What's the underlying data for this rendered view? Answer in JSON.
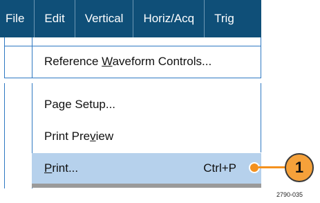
{
  "menubar": {
    "items": [
      "File",
      "Edit",
      "Vertical",
      "Horiz/Acq",
      "Trig"
    ]
  },
  "dropdown": {
    "reference_waveform": {
      "before": "Reference ",
      "mnemonic": "W",
      "after": "aveform Controls..."
    },
    "page_setup": "Page Setup...",
    "print_preview": {
      "before": "Print Pre",
      "mnemonic": "v",
      "after": "iew"
    },
    "print": {
      "mnemonic": "P",
      "after": "rint...",
      "shortcut": "Ctrl+P"
    }
  },
  "callout": {
    "number": "1"
  },
  "figure_id": "2790-035",
  "colors": {
    "menubar_bg": "#0f4f78",
    "highlight": "#b6d1ec",
    "callout_accent": "#f4911e",
    "border_blue": "#2e78c2"
  }
}
